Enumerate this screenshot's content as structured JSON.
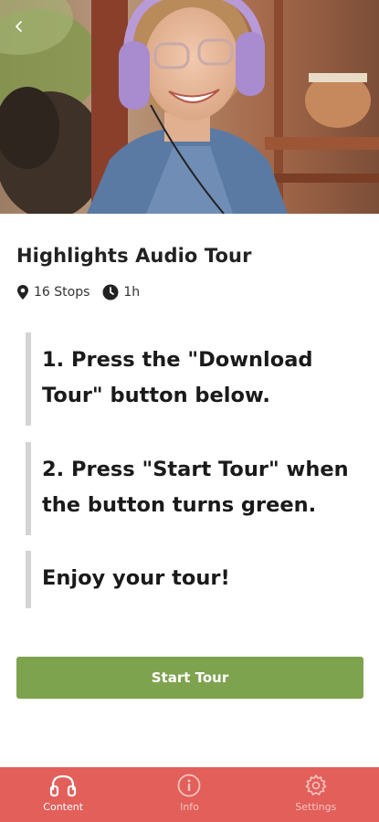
{
  "hero": {
    "image_description_icon": "woman-with-headphones-photo"
  },
  "tour": {
    "title": "Highlights Audio Tour",
    "stops_label": "16 Stops",
    "duration_label": "1h"
  },
  "instructions": [
    {
      "line1": "1. Press the \"Download",
      "line2": "Tour\" button below."
    },
    {
      "line1": "2. Press \"Start Tour\" when",
      "line2": "the button turns green."
    },
    {
      "line1": "Enjoy your tour!"
    }
  ],
  "start_button": {
    "label": "Start Tour",
    "color": "#7ea34e"
  },
  "bottom_nav": {
    "color": "#e25f5a",
    "items": [
      {
        "label": "Content",
        "icon": "headphones-icon",
        "active": true
      },
      {
        "label": "Info",
        "icon": "info-icon",
        "active": false
      },
      {
        "label": "Settings",
        "icon": "gear-icon",
        "active": false
      }
    ]
  }
}
